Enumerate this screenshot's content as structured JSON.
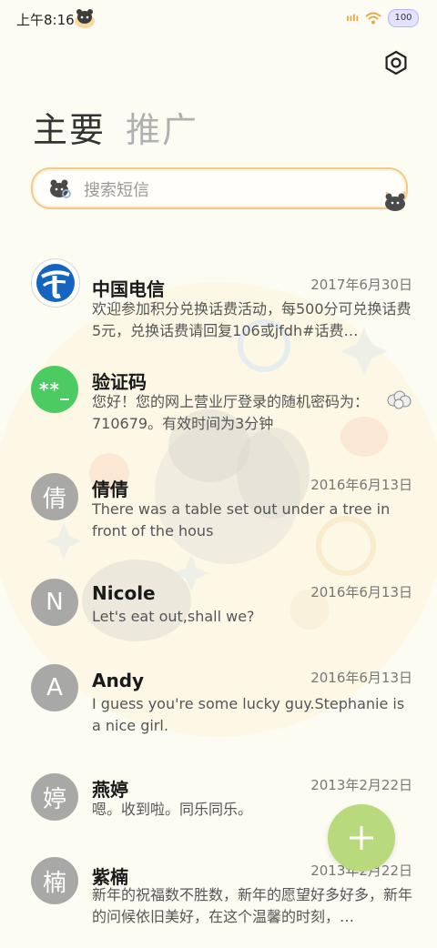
{
  "status_bar": {
    "time": "上午8:16",
    "signal_text": "ıılı",
    "battery": "100"
  },
  "tabs": {
    "primary": "主要",
    "secondary": "推广"
  },
  "search": {
    "placeholder": "搜索短信"
  },
  "messages": [
    {
      "avatar_text": "",
      "avatar_icon": "china-telecom-logo-icon",
      "sender": "中国电信",
      "date": "2017年6月30日",
      "preview": "欢迎参加积分兑换话费活动，每500分可兑换话费5元，兑换话费请回复106或jfdh#话费…"
    },
    {
      "avatar_text": "**_",
      "sender": "验证码",
      "date": "",
      "preview": "您好！您的网上营业厅登录的随机密码为：710679。有效时间为3分钟",
      "trailing_icon": "popcorn-icon"
    },
    {
      "avatar_text": "倩",
      "sender": "倩倩",
      "date": "2016年6月13日",
      "preview": "There was a table set out under a tree in front of the hous"
    },
    {
      "avatar_text": "N",
      "sender": "Nicole",
      "date": "2016年6月13日",
      "preview": "Let's eat out,shall we?"
    },
    {
      "avatar_text": "A",
      "sender": "Andy",
      "date": "2016年6月13日",
      "preview": "I guess you're some lucky guy.Stephanie is a nice girl."
    },
    {
      "avatar_text": "婷",
      "sender": "燕婷",
      "date": "2013年2月22日",
      "preview": "嗯。收到啦。同乐同乐。"
    },
    {
      "avatar_text": "楠",
      "sender": "紫楠",
      "date": "2013年2月22日",
      "preview": "新年的祝福数不胜数，新年的愿望好多好多，新年的问候依旧美好，在这个温馨的时刻，…"
    }
  ],
  "fab": {
    "icon": "plus-icon"
  },
  "colors": {
    "background": "#fdfcf2",
    "accent_fab": "#b9da7c",
    "verification_avatar": "#4ccb63",
    "avatar_gray": "#a8a8a6",
    "search_border": "#f3c98a"
  }
}
